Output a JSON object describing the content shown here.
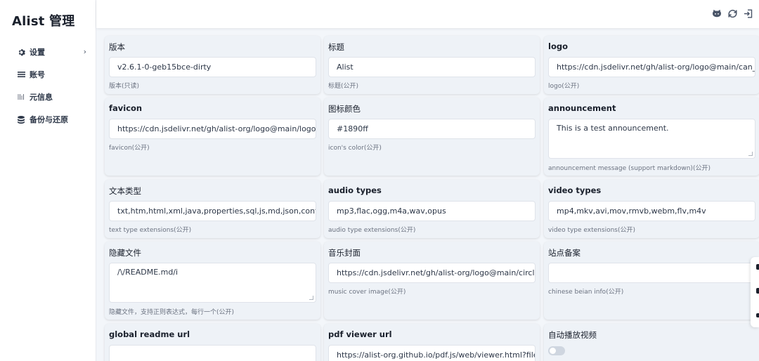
{
  "sidebar": {
    "brand": "Alist 管理",
    "items": [
      {
        "label": "设置",
        "icon": "gear-icon"
      },
      {
        "label": "账号",
        "icon": "list-icon"
      },
      {
        "label": "元信息",
        "icon": "meta-icon"
      },
      {
        "label": "备份与还原",
        "icon": "database-icon"
      }
    ],
    "chevron": "›"
  },
  "header": {
    "icons": [
      "github-icon",
      "refresh-icon",
      "logout-icon"
    ]
  },
  "cards": [
    {
      "label": "版本",
      "value": "v2.6.1-0-geb15bce-dirty",
      "help": "版本(只读)"
    },
    {
      "label": "标题",
      "value": "Alist",
      "help": "标题(公开)"
    },
    {
      "label": "logo",
      "value": "https://cdn.jsdelivr.net/gh/alist-org/logo@main/can_c",
      "help": "logo(公开)"
    },
    {
      "label": "favicon",
      "value": "https://cdn.jsdelivr.net/gh/alist-org/logo@main/logo.s",
      "help": "favicon(公开)"
    },
    {
      "label": "图标颜色",
      "value": "#1890ff",
      "help": "icon's color(公开)"
    },
    {
      "label": "announcement",
      "value": "This is a test announcement.",
      "help": "announcement message (support markdown)(公开)"
    },
    {
      "label": "文本类型",
      "value": "txt,htm,html,xml,java,properties,sql,js,md,json,conf,ini,v",
      "help": "text type extensions(公开)"
    },
    {
      "label": "audio types",
      "value": "mp3,flac,ogg,m4a,wav,opus",
      "help": "audio type extensions(公开)"
    },
    {
      "label": "video types",
      "value": "mp4,mkv,avi,mov,rmvb,webm,flv,m4v",
      "help": "video type extensions(公开)"
    },
    {
      "label": "隐藏文件",
      "value": "/\\/README.md/i",
      "help": "隐藏文件，支持正则表达式，每行一个(公开)"
    },
    {
      "label": "音乐封面",
      "value": "https://cdn.jsdelivr.net/gh/alist-org/logo@main/circle_",
      "help": "music cover image(公开)"
    },
    {
      "label": "站点备案",
      "value": "",
      "help": "chinese beian info(公开)"
    },
    {
      "label": "global readme url",
      "value": "",
      "help": ""
    },
    {
      "label": "pdf viewer url",
      "value": "https://alist-org.github.io/pdf.js/web/viewer.html?file",
      "help": ""
    },
    {
      "label": "自动播放视频",
      "value": "",
      "help": ""
    }
  ],
  "autoplay": {
    "enabled": false
  }
}
